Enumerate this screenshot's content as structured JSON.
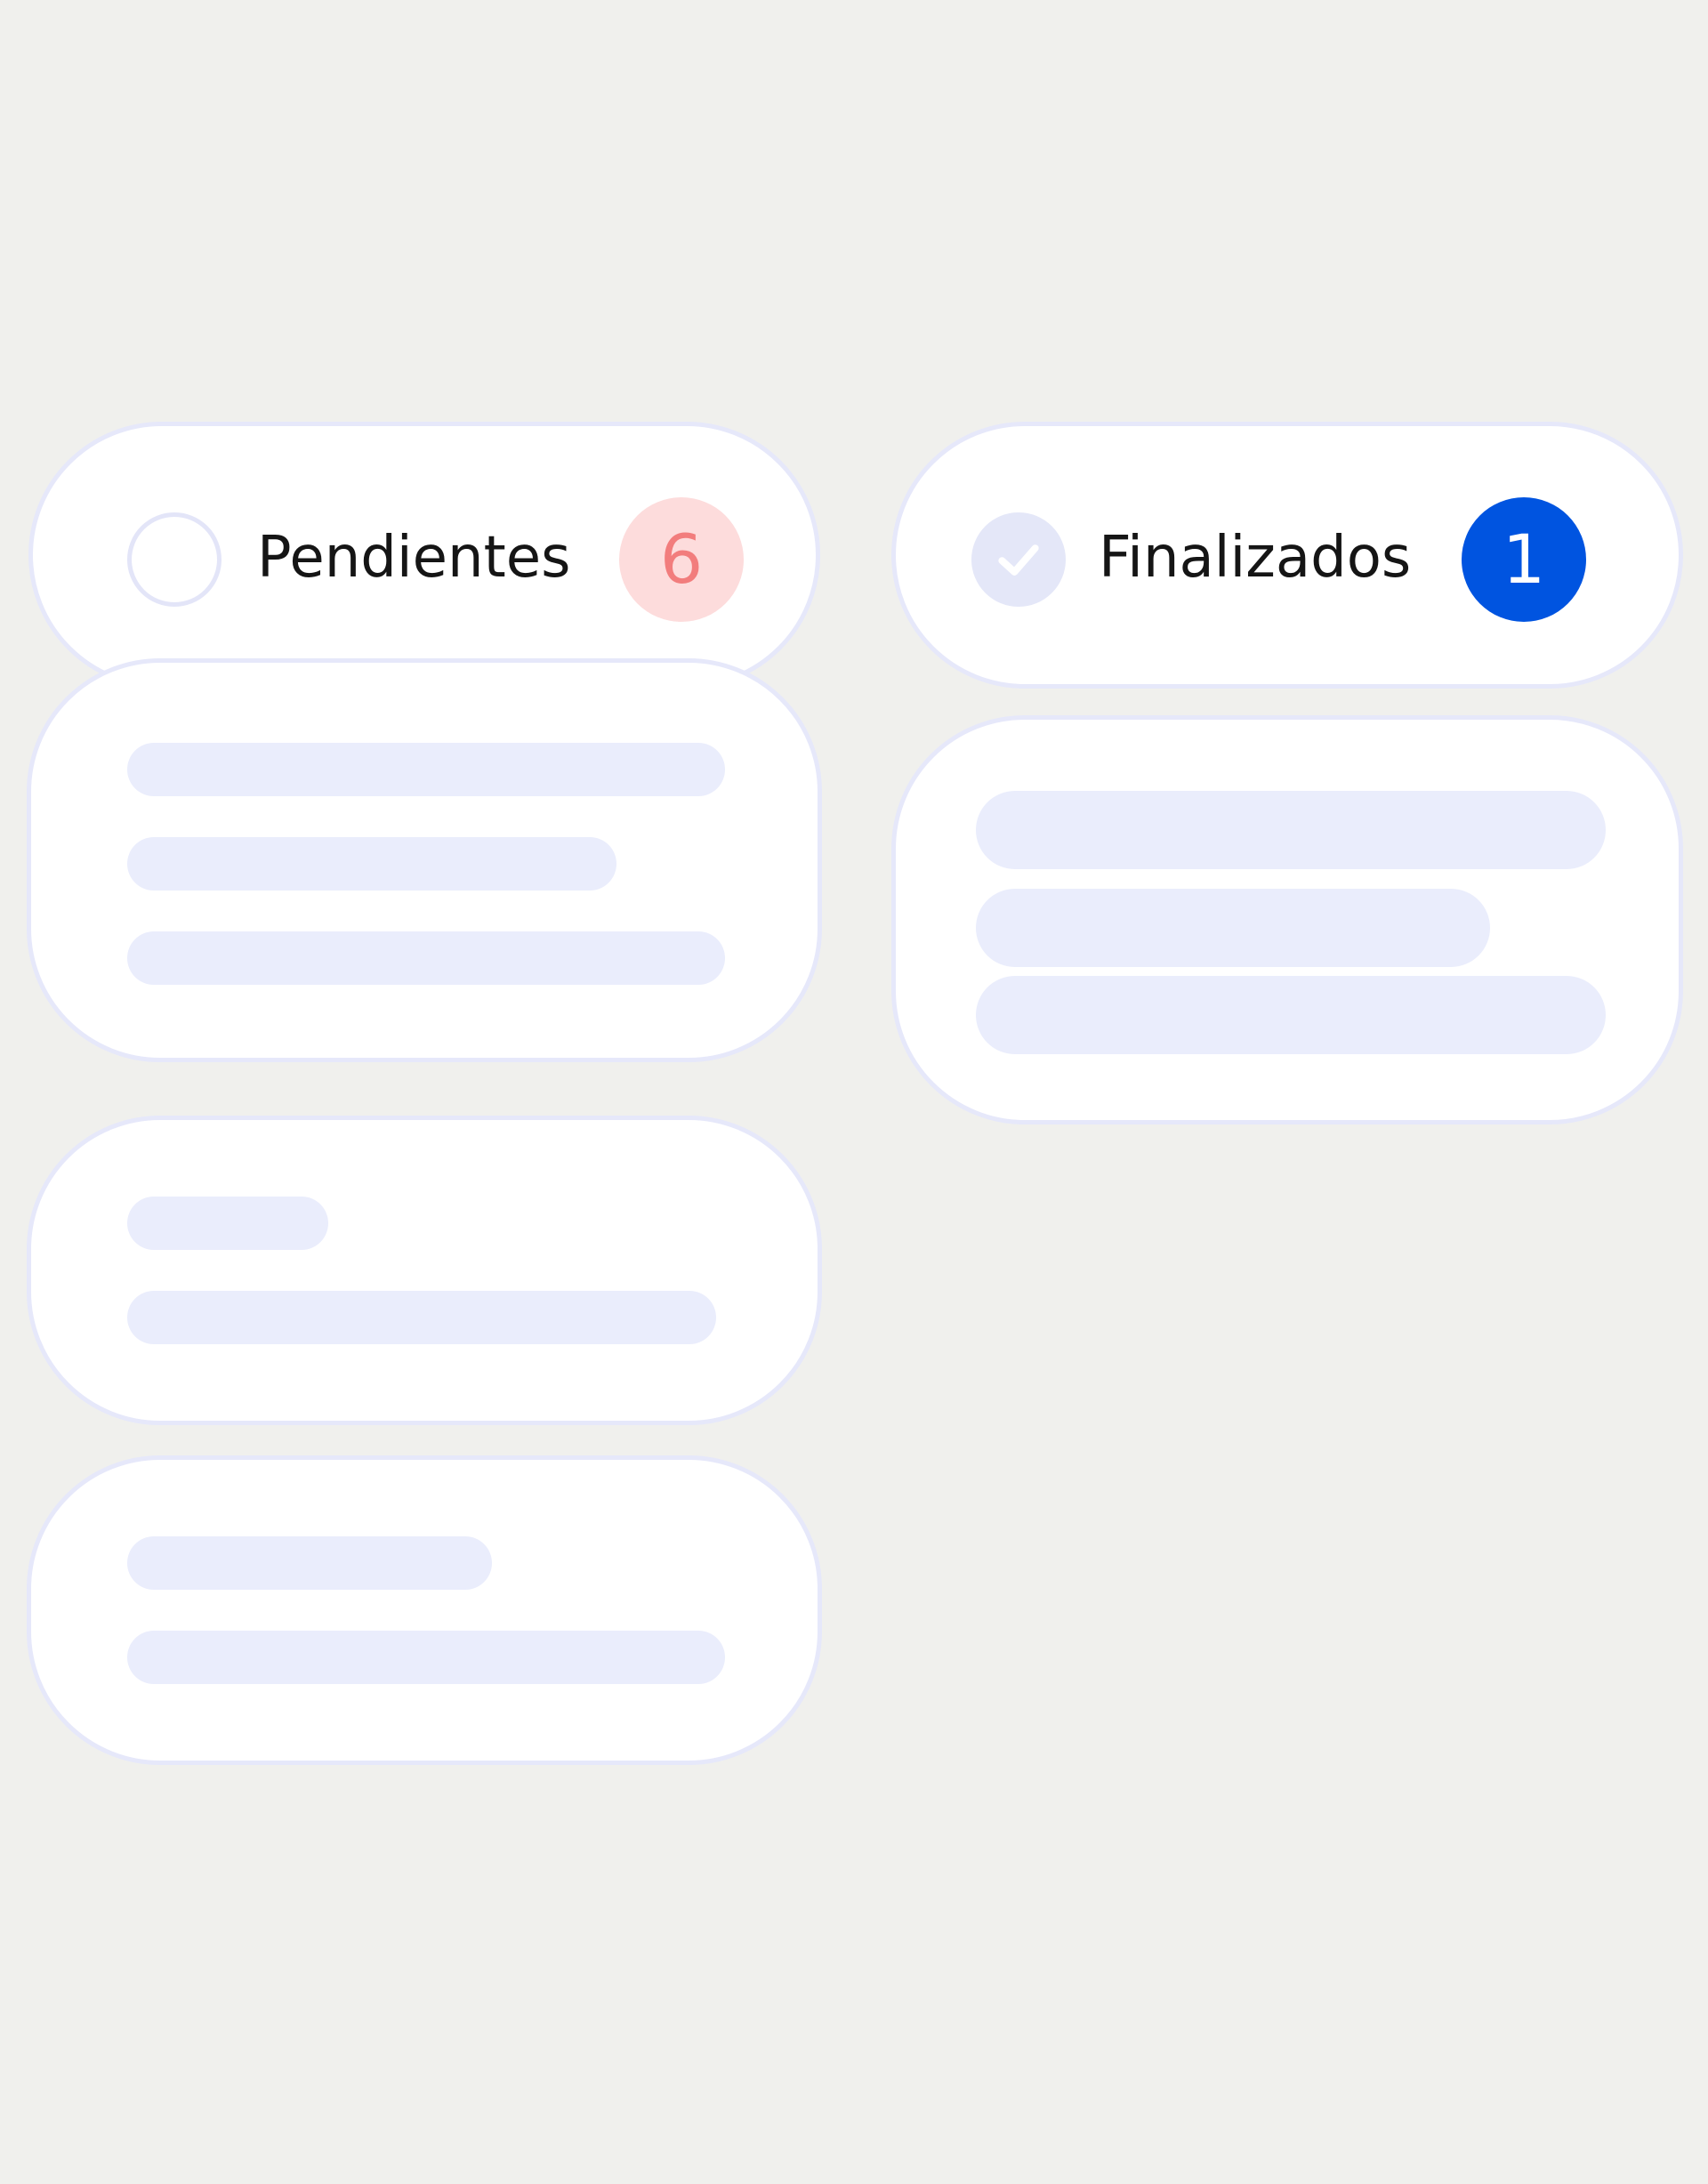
{
  "columns": {
    "pending": {
      "title": "Pendientes",
      "count": "6",
      "status_icon": "empty-circle",
      "badge_bg": "#fddcdc",
      "badge_text_color": "#f27d7d"
    },
    "done": {
      "title": "Finalizados",
      "count": "1",
      "status_icon": "check-circle",
      "badge_bg": "#0054e0",
      "badge_text_color": "#ffffff"
    }
  },
  "colors": {
    "background": "#f0f0ed",
    "card": "#ffffff",
    "card_border": "#e6e8fa",
    "placeholder_bar": "#eaedfc"
  }
}
